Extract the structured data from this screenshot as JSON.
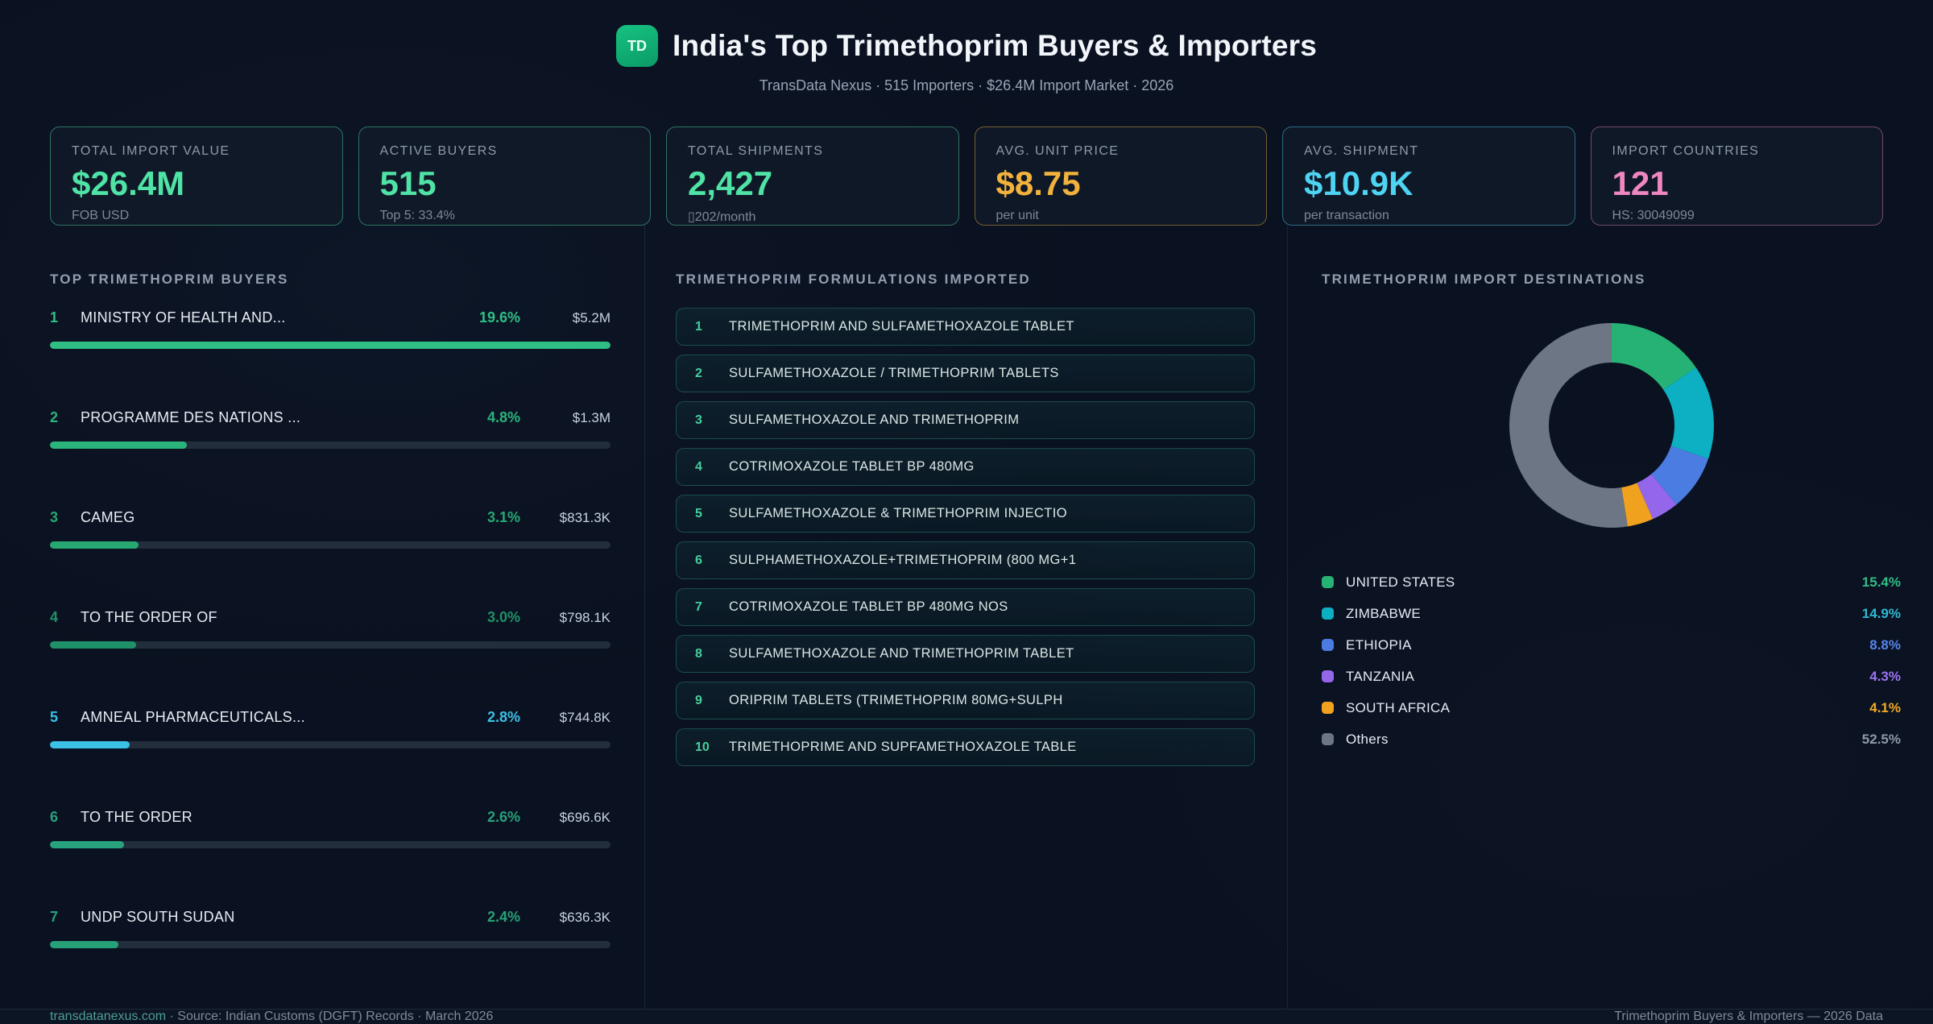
{
  "header": {
    "logo": "TD",
    "title": "India's Top Trimethoprim Buyers & Importers",
    "subtitle": "TransData Nexus · 515 Importers · $26.4M Import Market · 2026"
  },
  "stats": [
    {
      "label": "TOTAL IMPORT VALUE",
      "value": "$26.4M",
      "sub": "FOB USD",
      "accent": "#4fe3a6"
    },
    {
      "label": "ACTIVE BUYERS",
      "value": "515",
      "sub": "Top 5: 33.4%",
      "accent": "#4fe3a6"
    },
    {
      "label": "TOTAL SHIPMENTS",
      "value": "2,427",
      "sub": "▯202/month",
      "accent": "#4fe3a6"
    },
    {
      "label": "AVG. UNIT PRICE",
      "value": "$8.75",
      "sub": "per unit",
      "accent": "#f2b23c"
    },
    {
      "label": "AVG. SHIPMENT",
      "value": "$10.9K",
      "sub": "per transaction",
      "accent": "#4ed3f2"
    },
    {
      "label": "IMPORT COUNTRIES",
      "value": "121",
      "sub": "HS: 30049099",
      "accent": "#ee86c0"
    }
  ],
  "buyers": {
    "heading": "TOP TRIMETHOPRIM BUYERS",
    "rows": [
      {
        "rank": "1",
        "name": "MINISTRY OF HEALTH AND...",
        "pct": "19.6%",
        "value": "$5.2M",
        "accent": "#2fbf85"
      },
      {
        "rank": "2",
        "name": "PROGRAMME DES NATIONS ...",
        "pct": "4.8%",
        "value": "$1.3M",
        "accent": "#2bb37c"
      },
      {
        "rank": "3",
        "name": "CAMEG",
        "pct": "3.1%",
        "value": "$831.3K",
        "accent": "#27a873"
      },
      {
        "rank": "4",
        "name": "TO THE ORDER OF",
        "pct": "3.0%",
        "value": "$798.1K",
        "accent": "#1f9168"
      },
      {
        "rank": "5",
        "name": "AMNEAL PHARMACEUTICALS...",
        "pct": "2.8%",
        "value": "$744.8K",
        "accent": "#3bc0e6"
      },
      {
        "rank": "6",
        "name": "TO THE ORDER",
        "pct": "2.6%",
        "value": "$696.6K",
        "accent": "#28a17d"
      },
      {
        "rank": "7",
        "name": "UNDP SOUTH SUDAN",
        "pct": "2.4%",
        "value": "$636.3K",
        "accent": "#27a177"
      }
    ]
  },
  "formulations": {
    "heading": "TRIMETHOPRIM FORMULATIONS IMPORTED",
    "items": [
      {
        "num": "1",
        "name": "TRIMETHOPRIM AND SULFAMETHOXAZOLE TABLET"
      },
      {
        "num": "2",
        "name": "SULFAMETHOXAZOLE / TRIMETHOPRIM TABLETS"
      },
      {
        "num": "3",
        "name": "SULFAMETHOXAZOLE AND TRIMETHOPRIM"
      },
      {
        "num": "4",
        "name": "COTRIMOXAZOLE TABLET BP 480MG"
      },
      {
        "num": "5",
        "name": "SULFAMETHOXAZOLE & TRIMETHOPRIM INJECTIO"
      },
      {
        "num": "6",
        "name": "SULPHAMETHOXAZOLE+TRIMETHOPRIM (800 MG+1"
      },
      {
        "num": "7",
        "name": "COTRIMOXAZOLE TABLET BP 480MG NOS"
      },
      {
        "num": "8",
        "name": "SULFAMETHOXAZOLE AND TRIMETHOPRIM TABLET"
      },
      {
        "num": "9",
        "name": "ORIPRIM TABLETS (TRIMETHOPRIM 80MG+SULPH"
      },
      {
        "num": "10",
        "name": "TRIMETHOPRIME AND SUPFAMETHOXAZOLE TABLE"
      }
    ]
  },
  "destinations": {
    "heading": "TRIMETHOPRIM IMPORT DESTINATIONS",
    "legend": [
      {
        "label": "UNITED STATES",
        "pct": "15.4%",
        "color": "#26b274",
        "pct_color": "#2fbe84"
      },
      {
        "label": "ZIMBABWE",
        "pct": "14.9%",
        "color": "#0cb0c2",
        "pct_color": "#2eb9d4"
      },
      {
        "label": "ETHIOPIA",
        "pct": "8.8%",
        "color": "#4a7ce2",
        "pct_color": "#5585ea"
      },
      {
        "label": "TANZANIA",
        "pct": "4.3%",
        "color": "#9467ea",
        "pct_color": "#9c73f0"
      },
      {
        "label": "SOUTH AFRICA",
        "pct": "4.1%",
        "color": "#f0a21e",
        "pct_color": "#f2a825"
      },
      {
        "label": "Others",
        "pct": "52.5%",
        "color": "#6c7685",
        "pct_color": "#8f99a8"
      }
    ]
  },
  "chart_data": [
    {
      "type": "pie",
      "subtype": "donut",
      "title": "TRIMETHOPRIM IMPORT DESTINATIONS",
      "labels": [
        "UNITED STATES",
        "ZIMBABWE",
        "ETHIOPIA",
        "TANZANIA",
        "SOUTH AFRICA",
        "Others"
      ],
      "values": [
        15.4,
        14.9,
        8.8,
        4.3,
        4.1,
        52.5
      ],
      "colors": [
        "#26b274",
        "#0cb0c2",
        "#4a7ce2",
        "#9467ea",
        "#f0a21e",
        "#6c7685"
      ],
      "start_angle_deg": 0,
      "direction": "clockwise",
      "legend_position": "bottom"
    },
    {
      "type": "bar",
      "title": "TOP TRIMETHOPRIM BUYERS",
      "orientation": "horizontal",
      "categories": [
        "MINISTRY OF HEALTH AND...",
        "PROGRAMME DES NATIONS ...",
        "CAMEG",
        "TO THE ORDER OF",
        "AMNEAL PHARMACEUTICALS...",
        "TO THE ORDER",
        "UNDP SOUTH SUDAN"
      ],
      "values": [
        19.6,
        4.8,
        3.1,
        3.0,
        2.8,
        2.6,
        2.4
      ],
      "value_labels": [
        "$5.2M",
        "$1.3M",
        "$831.3K",
        "$798.1K",
        "$744.8K",
        "$696.6K",
        "$636.3K"
      ],
      "unit": "%",
      "xlim": [
        0,
        19.6
      ],
      "grid": false
    }
  ],
  "footer": {
    "left_domain": "transdatanexus.com",
    "left_rest": " · Source: Indian Customs (DGFT) Records · March 2026",
    "right": "Trimethoprim Buyers & Importers — 2026 Data"
  }
}
